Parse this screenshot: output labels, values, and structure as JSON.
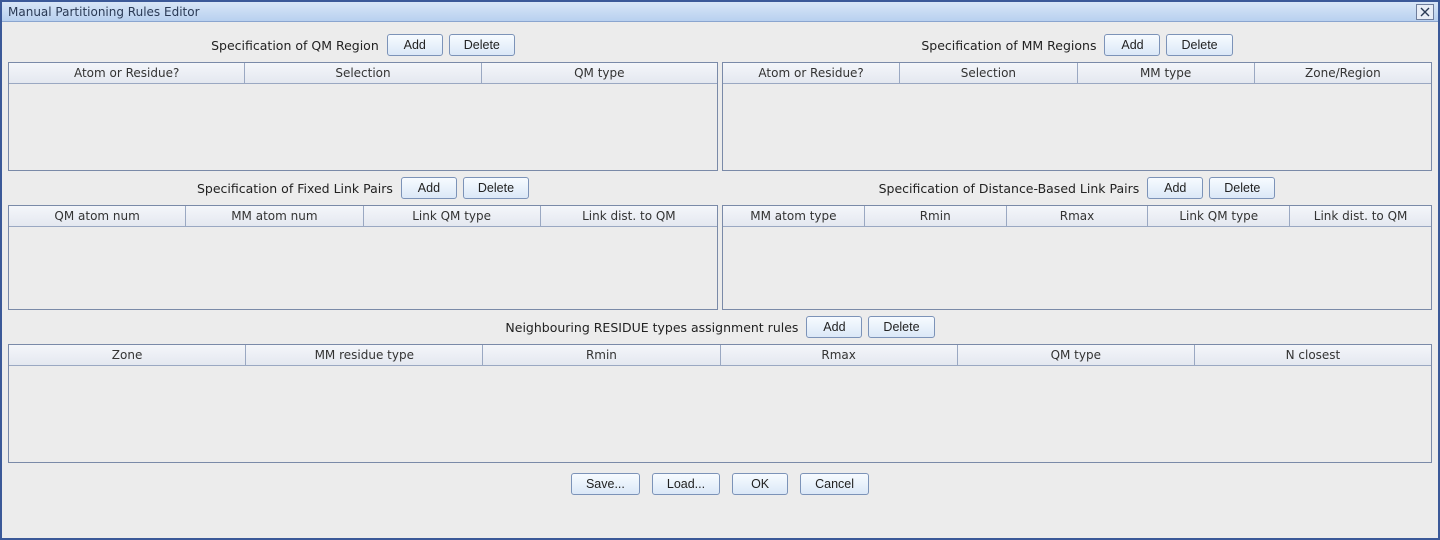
{
  "window": {
    "title": "Manual Partitioning Rules Editor"
  },
  "buttons": {
    "add": "Add",
    "delete": "Delete",
    "save": "Save...",
    "load": "Load...",
    "ok": "OK",
    "cancel": "Cancel"
  },
  "sections": {
    "qm_region": {
      "label": "Specification of QM Region",
      "columns": [
        "Atom or Residue?",
        "Selection",
        "QM type"
      ]
    },
    "mm_regions": {
      "label": "Specification of MM Regions",
      "columns": [
        "Atom or Residue?",
        "Selection",
        "MM type",
        "Zone/Region"
      ]
    },
    "fixed_link": {
      "label": "Specification of Fixed Link Pairs",
      "columns": [
        "QM atom num",
        "MM atom num",
        "Link QM type",
        "Link dist. to QM"
      ]
    },
    "dist_link": {
      "label": "Specification of Distance-Based Link Pairs",
      "columns": [
        "MM atom type",
        "Rmin",
        "Rmax",
        "Link QM type",
        "Link dist. to QM"
      ]
    },
    "neighbouring": {
      "label": "Neighbouring RESIDUE types assignment rules",
      "columns": [
        "Zone",
        "MM residue type",
        "Rmin",
        "Rmax",
        "QM type",
        "N closest"
      ]
    }
  }
}
